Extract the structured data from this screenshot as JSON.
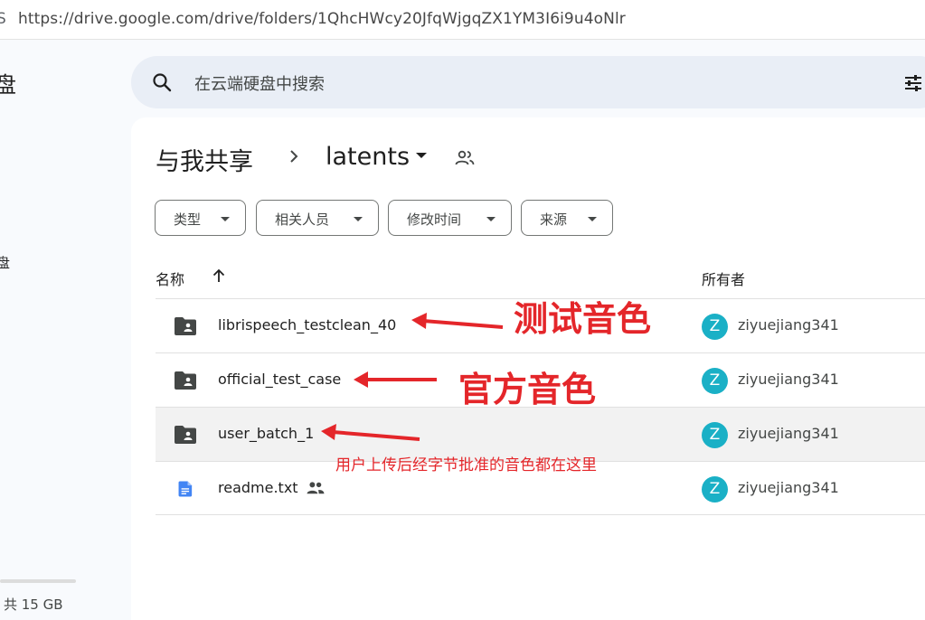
{
  "browser": {
    "url": "https://drive.google.com/drive/folders/1QhcHWcy20JfqWjgqZX1YM3I6i9u4oNlr",
    "url_prefix_glyph": "S"
  },
  "sidebar": {
    "title_fragment": "盘",
    "nav_fragment": "盘",
    "storage_text": "共 15 GB"
  },
  "search": {
    "placeholder": "在云端硬盘中搜索"
  },
  "breadcrumb": {
    "root": "与我共享",
    "current": "latents"
  },
  "filters": [
    {
      "label": "类型"
    },
    {
      "label": "相关人员"
    },
    {
      "label": "修改时间"
    },
    {
      "label": "来源"
    }
  ],
  "table": {
    "col_name": "名称",
    "col_owner": "所有者",
    "rows": [
      {
        "name": "librispeech_testclean_40",
        "type": "shared-folder",
        "owner_initial": "Z",
        "owner": "ziyuejiang341"
      },
      {
        "name": "official_test_case",
        "type": "shared-folder",
        "owner_initial": "Z",
        "owner": "ziyuejiang341"
      },
      {
        "name": "user_batch_1",
        "type": "shared-folder",
        "owner_initial": "Z",
        "owner": "ziyuejiang341"
      },
      {
        "name": "readme.txt",
        "type": "doc",
        "owner_initial": "Z",
        "owner": "ziyuejiang341"
      }
    ]
  },
  "annotations": {
    "test_voice": "测试音色",
    "official_voice": "官方音色",
    "user_note": "用户上传后经字节批准的音色都在这里",
    "color": "#e4262a"
  },
  "colors": {
    "avatar": "#1ab0c6",
    "search_bg": "#e9eef6",
    "page_bg": "#f8fafd"
  }
}
